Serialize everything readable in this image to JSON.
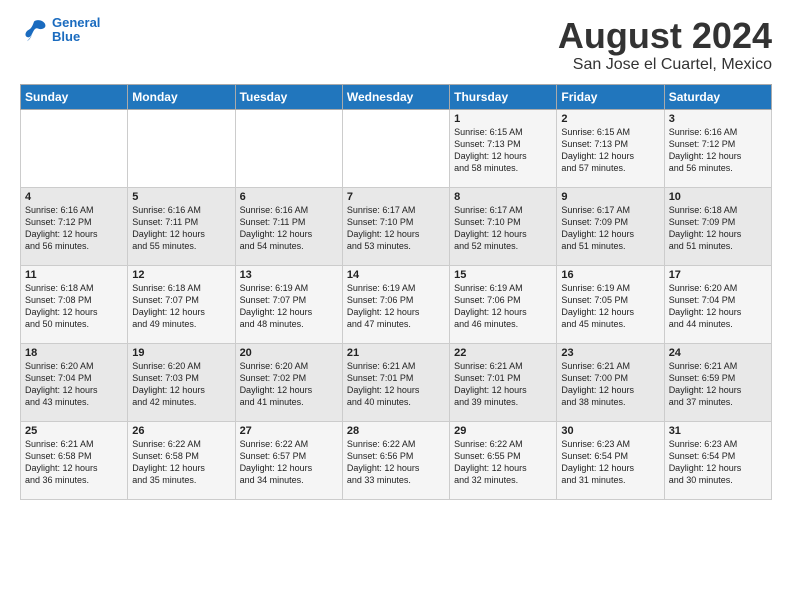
{
  "header": {
    "logo_line1": "General",
    "logo_line2": "Blue",
    "main_title": "August 2024",
    "subtitle": "San Jose el Cuartel, Mexico"
  },
  "days_of_week": [
    "Sunday",
    "Monday",
    "Tuesday",
    "Wednesday",
    "Thursday",
    "Friday",
    "Saturday"
  ],
  "weeks": [
    [
      {
        "day": "",
        "info": ""
      },
      {
        "day": "",
        "info": ""
      },
      {
        "day": "",
        "info": ""
      },
      {
        "day": "",
        "info": ""
      },
      {
        "day": "1",
        "info": "Sunrise: 6:15 AM\nSunset: 7:13 PM\nDaylight: 12 hours\nand 58 minutes."
      },
      {
        "day": "2",
        "info": "Sunrise: 6:15 AM\nSunset: 7:13 PM\nDaylight: 12 hours\nand 57 minutes."
      },
      {
        "day": "3",
        "info": "Sunrise: 6:16 AM\nSunset: 7:12 PM\nDaylight: 12 hours\nand 56 minutes."
      }
    ],
    [
      {
        "day": "4",
        "info": "Sunrise: 6:16 AM\nSunset: 7:12 PM\nDaylight: 12 hours\nand 56 minutes."
      },
      {
        "day": "5",
        "info": "Sunrise: 6:16 AM\nSunset: 7:11 PM\nDaylight: 12 hours\nand 55 minutes."
      },
      {
        "day": "6",
        "info": "Sunrise: 6:16 AM\nSunset: 7:11 PM\nDaylight: 12 hours\nand 54 minutes."
      },
      {
        "day": "7",
        "info": "Sunrise: 6:17 AM\nSunset: 7:10 PM\nDaylight: 12 hours\nand 53 minutes."
      },
      {
        "day": "8",
        "info": "Sunrise: 6:17 AM\nSunset: 7:10 PM\nDaylight: 12 hours\nand 52 minutes."
      },
      {
        "day": "9",
        "info": "Sunrise: 6:17 AM\nSunset: 7:09 PM\nDaylight: 12 hours\nand 51 minutes."
      },
      {
        "day": "10",
        "info": "Sunrise: 6:18 AM\nSunset: 7:09 PM\nDaylight: 12 hours\nand 51 minutes."
      }
    ],
    [
      {
        "day": "11",
        "info": "Sunrise: 6:18 AM\nSunset: 7:08 PM\nDaylight: 12 hours\nand 50 minutes."
      },
      {
        "day": "12",
        "info": "Sunrise: 6:18 AM\nSunset: 7:07 PM\nDaylight: 12 hours\nand 49 minutes."
      },
      {
        "day": "13",
        "info": "Sunrise: 6:19 AM\nSunset: 7:07 PM\nDaylight: 12 hours\nand 48 minutes."
      },
      {
        "day": "14",
        "info": "Sunrise: 6:19 AM\nSunset: 7:06 PM\nDaylight: 12 hours\nand 47 minutes."
      },
      {
        "day": "15",
        "info": "Sunrise: 6:19 AM\nSunset: 7:06 PM\nDaylight: 12 hours\nand 46 minutes."
      },
      {
        "day": "16",
        "info": "Sunrise: 6:19 AM\nSunset: 7:05 PM\nDaylight: 12 hours\nand 45 minutes."
      },
      {
        "day": "17",
        "info": "Sunrise: 6:20 AM\nSunset: 7:04 PM\nDaylight: 12 hours\nand 44 minutes."
      }
    ],
    [
      {
        "day": "18",
        "info": "Sunrise: 6:20 AM\nSunset: 7:04 PM\nDaylight: 12 hours\nand 43 minutes."
      },
      {
        "day": "19",
        "info": "Sunrise: 6:20 AM\nSunset: 7:03 PM\nDaylight: 12 hours\nand 42 minutes."
      },
      {
        "day": "20",
        "info": "Sunrise: 6:20 AM\nSunset: 7:02 PM\nDaylight: 12 hours\nand 41 minutes."
      },
      {
        "day": "21",
        "info": "Sunrise: 6:21 AM\nSunset: 7:01 PM\nDaylight: 12 hours\nand 40 minutes."
      },
      {
        "day": "22",
        "info": "Sunrise: 6:21 AM\nSunset: 7:01 PM\nDaylight: 12 hours\nand 39 minutes."
      },
      {
        "day": "23",
        "info": "Sunrise: 6:21 AM\nSunset: 7:00 PM\nDaylight: 12 hours\nand 38 minutes."
      },
      {
        "day": "24",
        "info": "Sunrise: 6:21 AM\nSunset: 6:59 PM\nDaylight: 12 hours\nand 37 minutes."
      }
    ],
    [
      {
        "day": "25",
        "info": "Sunrise: 6:21 AM\nSunset: 6:58 PM\nDaylight: 12 hours\nand 36 minutes."
      },
      {
        "day": "26",
        "info": "Sunrise: 6:22 AM\nSunset: 6:58 PM\nDaylight: 12 hours\nand 35 minutes."
      },
      {
        "day": "27",
        "info": "Sunrise: 6:22 AM\nSunset: 6:57 PM\nDaylight: 12 hours\nand 34 minutes."
      },
      {
        "day": "28",
        "info": "Sunrise: 6:22 AM\nSunset: 6:56 PM\nDaylight: 12 hours\nand 33 minutes."
      },
      {
        "day": "29",
        "info": "Sunrise: 6:22 AM\nSunset: 6:55 PM\nDaylight: 12 hours\nand 32 minutes."
      },
      {
        "day": "30",
        "info": "Sunrise: 6:23 AM\nSunset: 6:54 PM\nDaylight: 12 hours\nand 31 minutes."
      },
      {
        "day": "31",
        "info": "Sunrise: 6:23 AM\nSunset: 6:54 PM\nDaylight: 12 hours\nand 30 minutes."
      }
    ]
  ]
}
